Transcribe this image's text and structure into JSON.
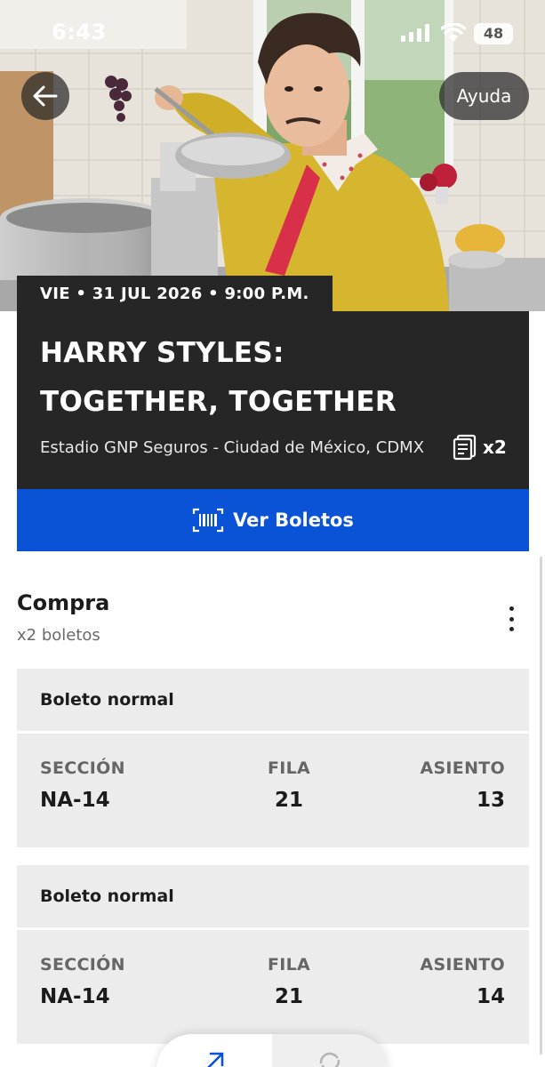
{
  "status_bar": {
    "time": "6:43",
    "battery": "48"
  },
  "header": {
    "help_label": "Ayuda"
  },
  "event": {
    "date_line": "VIE • 31 JUL 2026 • 9:00 P.M.",
    "title_line1": "HARRY STYLES:",
    "title_line2": "TOGETHER, TOGETHER",
    "venue": "Estadio GNP Seguros - Ciudad de México, CDMX",
    "ticket_count": "x2"
  },
  "view_tickets_label": "Ver Boletos",
  "purchase": {
    "title": "Compra",
    "subtitle": "x2 boletos",
    "tickets": [
      {
        "type": "Boleto normal",
        "section_label": "SECCIÓN",
        "section": "NA-14",
        "row_label": "FILA",
        "row": "21",
        "seat_label": "ASIENTO",
        "seat": "13"
      },
      {
        "type": "Boleto normal",
        "section_label": "SECCIÓN",
        "section": "NA-14",
        "row_label": "FILA",
        "row": "21",
        "seat_label": "ASIENTO",
        "seat": "14"
      }
    ]
  },
  "colors": {
    "card_dark": "#262626",
    "accent_blue": "#0a52d6",
    "ticket_bg": "#ececec",
    "sweater": "#d6b62e",
    "tie": "#d9304a"
  }
}
